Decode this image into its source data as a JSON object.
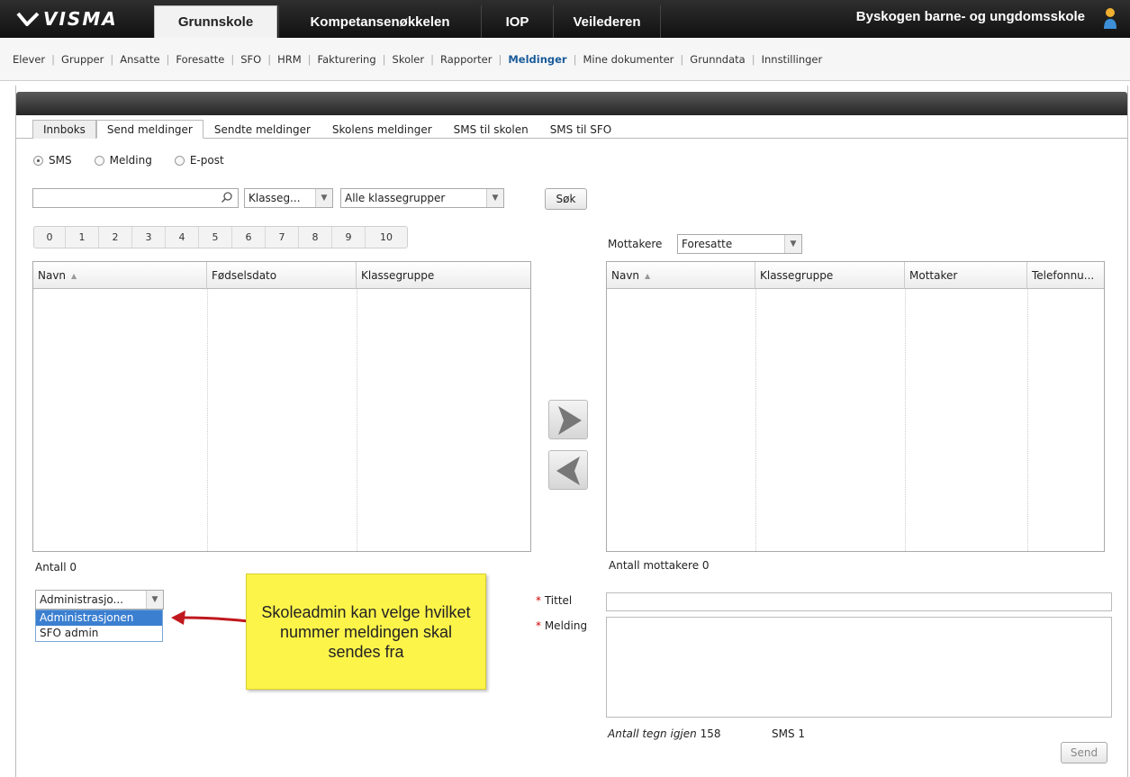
{
  "header": {
    "logo_text": "VISMA",
    "tabs": [
      {
        "label": "Grunnskole",
        "active": true
      },
      {
        "label": "Kompetansenøkkelen",
        "active": false
      },
      {
        "label": "IOP",
        "active": false
      },
      {
        "label": "Veilederen",
        "active": false
      }
    ],
    "school_name": "Byskogen barne- og ungdomsskole"
  },
  "subnav": {
    "items": [
      "Elever",
      "Grupper",
      "Ansatte",
      "Foresatte",
      "SFO",
      "HRM",
      "Fakturering",
      "Skoler",
      "Rapporter",
      "Meldinger",
      "Mine dokumenter",
      "Grunndata",
      "Innstillinger"
    ],
    "active": "Meldinger"
  },
  "tabs": {
    "items": [
      "Innboks",
      "Send meldinger",
      "Sendte meldinger",
      "Skolens meldinger",
      "SMS til skolen",
      "SMS til SFO"
    ],
    "active": "Send meldinger"
  },
  "message_type": {
    "options": [
      "SMS",
      "Melding",
      "E-post"
    ],
    "selected": "SMS"
  },
  "search": {
    "value": "",
    "filter_type": "Klasseg...",
    "filter_group": "Alle klassegrupper",
    "button_label": "Søk"
  },
  "number_filter": [
    "0",
    "1",
    "2",
    "3",
    "4",
    "5",
    "6",
    "7",
    "8",
    "9",
    "10"
  ],
  "students_grid": {
    "columns": [
      "Navn",
      "Fødselsdato",
      "Klassegruppe"
    ],
    "rows": [],
    "count_label": "Antall 0"
  },
  "recipients": {
    "label": "Mottakere",
    "type": "Foresatte",
    "columns": [
      "Navn",
      "Klassegruppe",
      "Mottaker",
      "Telefonnu..."
    ],
    "rows": [],
    "count_label": "Antall mottakere 0"
  },
  "sender": {
    "selected": "Administrasjo...",
    "options": [
      "Administrasjonen",
      "SFO admin"
    ],
    "highlighted": "Administrasjonen"
  },
  "annotation": {
    "text": "Skoleadmin kan velge hvilket nummer meldingen skal sendes fra"
  },
  "message": {
    "title_label": "Tittel",
    "body_label": "Melding",
    "required_mark": "*",
    "title_value": "",
    "body_value": "",
    "chars_left_label": "Antall tegn igjen",
    "chars_left": "158",
    "sms_count": "SMS 1",
    "send_label": "Send"
  }
}
